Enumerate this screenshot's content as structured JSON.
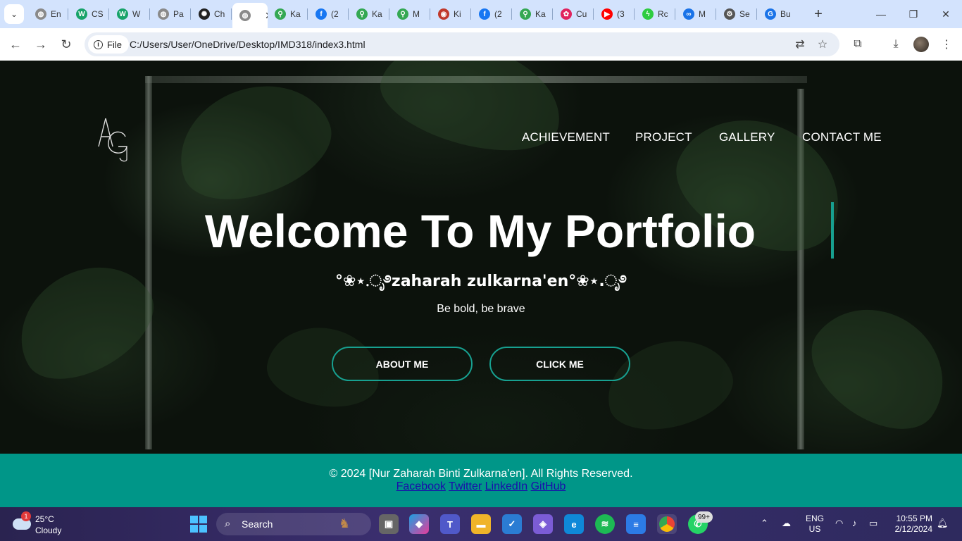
{
  "browser": {
    "tabs": [
      {
        "label": "En",
        "icon": "globe-icon",
        "color": "#8a8a8a"
      },
      {
        "label": "CS",
        "icon": "w-icon",
        "color": "#18a36a"
      },
      {
        "label": "W",
        "icon": "w-icon",
        "color": "#18a36a"
      },
      {
        "label": "Pa",
        "icon": "globe-icon",
        "color": "#8a8a8a"
      },
      {
        "label": "Ch",
        "icon": "chatgpt-icon",
        "color": "#222222"
      },
      {
        "label": "",
        "icon": "globe-icon",
        "color": "#8a8a8a",
        "active": true
      },
      {
        "label": "Ka",
        "icon": "maps-icon",
        "color": "#34a853"
      },
      {
        "label": "(2",
        "icon": "facebook-icon",
        "color": "#1877f2"
      },
      {
        "label": "Ka",
        "icon": "maps-icon",
        "color": "#34a853"
      },
      {
        "label": "M",
        "icon": "maps-icon",
        "color": "#34a853"
      },
      {
        "label": "Ki",
        "icon": "avatar-icon",
        "color": "#c0392b"
      },
      {
        "label": "(2",
        "icon": "facebook-icon",
        "color": "#1877f2"
      },
      {
        "label": "Ka",
        "icon": "maps-icon",
        "color": "#34a853"
      },
      {
        "label": "Cu",
        "icon": "puzzle-icon",
        "color": "#e0245e"
      },
      {
        "label": "(3",
        "icon": "youtube-icon",
        "color": "#ff0000"
      },
      {
        "label": "Rc",
        "icon": "flash-icon",
        "color": "#2ecc40"
      },
      {
        "label": "M",
        "icon": "meta-icon",
        "color": "#1a73e8"
      },
      {
        "label": "Se",
        "icon": "gear-icon",
        "color": "#555555"
      },
      {
        "label": "Bu",
        "icon": "gif-icon",
        "color": "#1a73e8"
      }
    ],
    "address_chip": "File",
    "url": "C:/Users/User/OneDrive/Desktop/IMD318/index3.html"
  },
  "site": {
    "nav": [
      "ACHIEVEMENT",
      "PROJECT",
      "GALLERY",
      "CONTACT ME"
    ],
    "title": "Welcome To My Portfolio",
    "name": "°❀⋆.ೃ࿔zaharah zulkarna'en°❀⋆.ೃ࿔",
    "tagline": "Be bold, be brave",
    "buttons": {
      "about": "ABOUT ME",
      "click": "CLICK ME"
    },
    "footer": {
      "copyright": "© 2024 [Nur Zaharah Binti Zulkarna'en]. All Rights Reserved.",
      "links": [
        "Facebook",
        "Twitter",
        "LinkedIn",
        "GitHub"
      ]
    },
    "colors": {
      "accent": "#17a090",
      "footer_bg": "#009688",
      "link": "#1a0dab"
    }
  },
  "taskbar": {
    "weather": {
      "temp": "25°C",
      "condition": "Cloudy",
      "badge": "1"
    },
    "search_label": "Search",
    "whatsapp_badge": "99+",
    "lang": [
      "ENG",
      "US"
    ],
    "time": "10:55 PM",
    "date": "2/12/2024"
  }
}
